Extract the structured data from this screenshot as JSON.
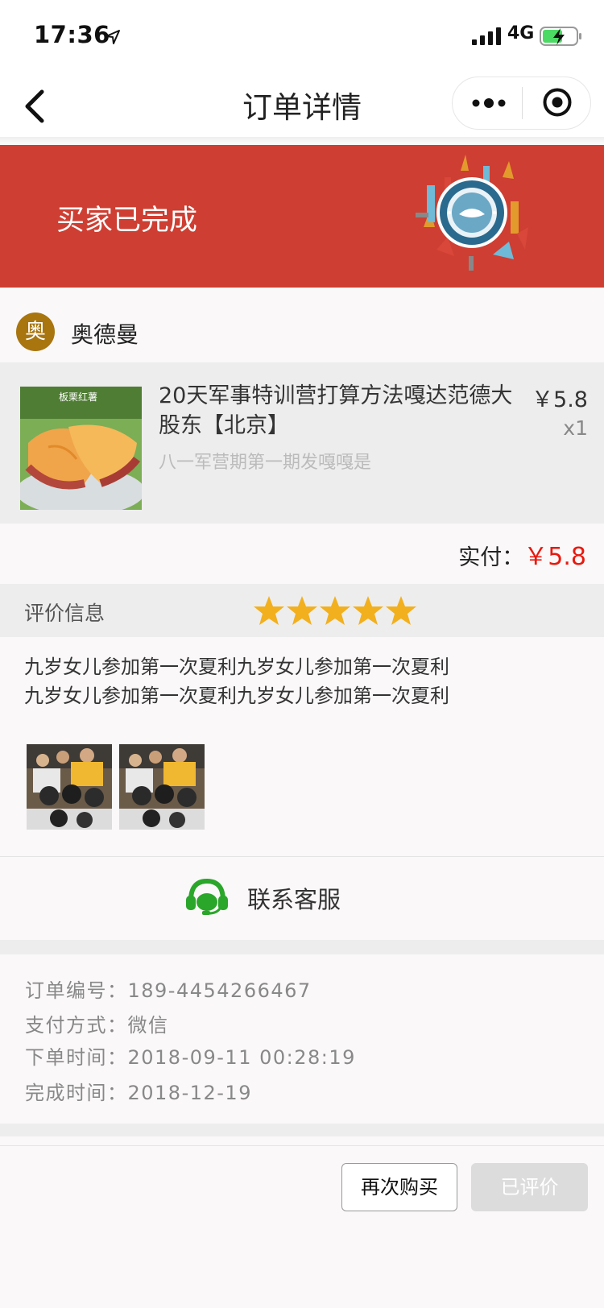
{
  "status": {
    "time": "17:36",
    "network": "4G"
  },
  "nav": {
    "title": "订单详情"
  },
  "banner": {
    "status_text": "买家已完成"
  },
  "shop": {
    "avatar_char": "奥",
    "name": "奥德曼"
  },
  "product": {
    "image_caption": "板栗红薯",
    "title": "20天军事特训营打算方法嘎达范德大股东【北京】",
    "subtitle": "八一军营期第一期发嘎嘎是",
    "price": "￥5.8",
    "quantity": "x1"
  },
  "payment": {
    "paid_label": "实付：",
    "paid_amount": "￥5.8"
  },
  "review": {
    "label": "评价信息",
    "rating": 5,
    "rating_max": 5,
    "text_line1": "九岁女儿参加第一次夏利九岁女儿参加第一次夏利",
    "text_line2": "九岁女儿参加第一次夏利九岁女儿参加第一次夏利"
  },
  "contact": {
    "label": "联系客服"
  },
  "order_info": {
    "order_no": "订单编号：189-4454266467",
    "pay_method": "支付方式：微信",
    "order_time": "下单时间：2018-09-11  00:28:19",
    "finish_time": "完成时间：2018-12-19"
  },
  "actions": {
    "rebuy_label": "再次购买",
    "reviewed_label": "已评价"
  },
  "colors": {
    "banner": "#ce3e32",
    "price_red": "#e8190f",
    "star_gold": "#f2b01e",
    "service_green": "#2aa62a"
  }
}
